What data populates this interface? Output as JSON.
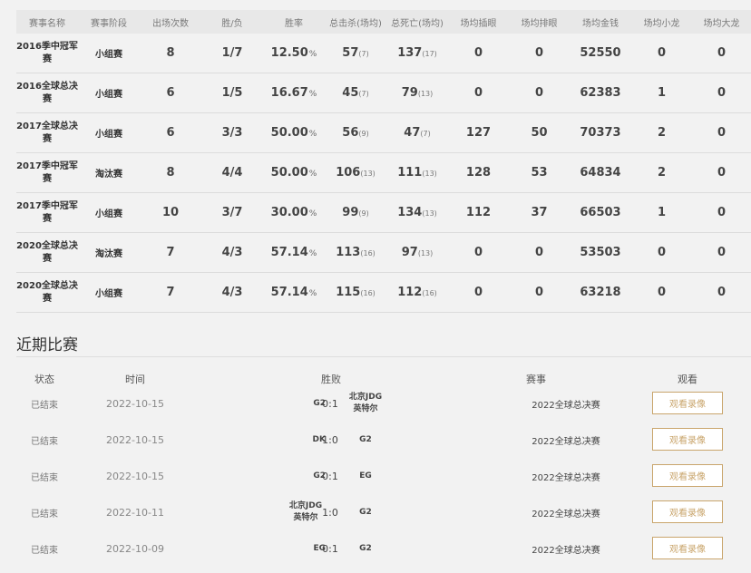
{
  "stats": {
    "headers": [
      "赛事名称",
      "赛事阶段",
      "出场次数",
      "胜/负",
      "胜率",
      "总击杀(场均)",
      "总死亡(场均)",
      "场均插眼",
      "场均排眼",
      "场均金钱",
      "场均小龙",
      "场均大龙"
    ],
    "rows": [
      {
        "name": "2016季中冠军赛",
        "stage": "小组赛",
        "games": "8",
        "wl": "1/7",
        "rate": "12.50",
        "rate_unit": "%",
        "kills": "57",
        "kills_avg": "(7)",
        "deaths": "137",
        "deaths_avg": "(17)",
        "wards": "0",
        "wards_cleared": "0",
        "gold": "52550",
        "dragons": "0",
        "barons": "0"
      },
      {
        "name": "2016全球总决赛",
        "stage": "小组赛",
        "games": "6",
        "wl": "1/5",
        "rate": "16.67",
        "rate_unit": "%",
        "kills": "45",
        "kills_avg": "(7)",
        "deaths": "79",
        "deaths_avg": "(13)",
        "wards": "0",
        "wards_cleared": "0",
        "gold": "62383",
        "dragons": "1",
        "barons": "0"
      },
      {
        "name": "2017全球总决赛",
        "stage": "小组赛",
        "games": "6",
        "wl": "3/3",
        "rate": "50.00",
        "rate_unit": "%",
        "kills": "56",
        "kills_avg": "(9)",
        "deaths": "47",
        "deaths_avg": "(7)",
        "wards": "127",
        "wards_cleared": "50",
        "gold": "70373",
        "dragons": "2",
        "barons": "0"
      },
      {
        "name": "2017季中冠军赛",
        "stage": "淘汰赛",
        "games": "8",
        "wl": "4/4",
        "rate": "50.00",
        "rate_unit": "%",
        "kills": "106",
        "kills_avg": "(13)",
        "deaths": "111",
        "deaths_avg": "(13)",
        "wards": "128",
        "wards_cleared": "53",
        "gold": "64834",
        "dragons": "2",
        "barons": "0"
      },
      {
        "name": "2017季中冠军赛",
        "stage": "小组赛",
        "games": "10",
        "wl": "3/7",
        "rate": "30.00",
        "rate_unit": "%",
        "kills": "99",
        "kills_avg": "(9)",
        "deaths": "134",
        "deaths_avg": "(13)",
        "wards": "112",
        "wards_cleared": "37",
        "gold": "66503",
        "dragons": "1",
        "barons": "0"
      },
      {
        "name": "2020全球总决赛",
        "stage": "淘汰赛",
        "games": "7",
        "wl": "4/3",
        "rate": "57.14",
        "rate_unit": "%",
        "kills": "113",
        "kills_avg": "(16)",
        "deaths": "97",
        "deaths_avg": "(13)",
        "wards": "0",
        "wards_cleared": "0",
        "gold": "53503",
        "dragons": "0",
        "barons": "0"
      },
      {
        "name": "2020全球总决赛",
        "stage": "小组赛",
        "games": "7",
        "wl": "4/3",
        "rate": "57.14",
        "rate_unit": "%",
        "kills": "115",
        "kills_avg": "(16)",
        "deaths": "112",
        "deaths_avg": "(16)",
        "wards": "0",
        "wards_cleared": "0",
        "gold": "63218",
        "dragons": "0",
        "barons": "0"
      }
    ]
  },
  "recent": {
    "title": "近期比赛",
    "headers": {
      "status": "状态",
      "time": "时间",
      "result": "胜败",
      "event": "赛事",
      "watch": "观看"
    },
    "matches": [
      {
        "status": "已结束",
        "date": "2022-10-15",
        "team1": "G2",
        "score": "0:1",
        "team2": "北京JDG英特尔",
        "event": "2022全球总决赛",
        "watch": "观看录像"
      },
      {
        "status": "已结束",
        "date": "2022-10-15",
        "team1": "DK",
        "score": "1:0",
        "team2": "G2",
        "event": "2022全球总决赛",
        "watch": "观看录像"
      },
      {
        "status": "已结束",
        "date": "2022-10-15",
        "team1": "G2",
        "score": "0:1",
        "team2": "EG",
        "event": "2022全球总决赛",
        "watch": "观看录像"
      },
      {
        "status": "已结束",
        "date": "2022-10-11",
        "team1": "北京JDG英特尔",
        "score": "1:0",
        "team2": "G2",
        "event": "2022全球总决赛",
        "watch": "观看录像"
      },
      {
        "status": "已结束",
        "date": "2022-10-09",
        "team1": "EG",
        "score": "0:1",
        "team2": "G2",
        "event": "2022全球总决赛",
        "watch": "观看录像"
      }
    ]
  }
}
